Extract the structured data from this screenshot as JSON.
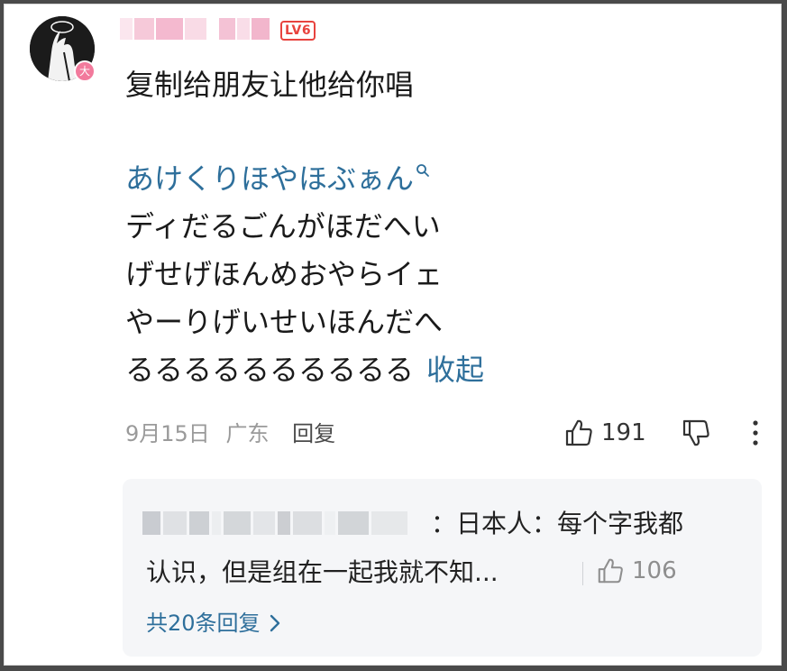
{
  "user": {
    "level": "LV6",
    "avatar_badge": "大"
  },
  "comment": {
    "intro": "复制给朋友让他给你唱",
    "song_link": "あけくりほやほぶぁん",
    "lines": [
      "ディだるごんがほだへい",
      "げせげほんめおやらイェ",
      "やーりげいせいほんだへ"
    ],
    "last_line": "るるるるるるるるるる",
    "collapse_label": "收起"
  },
  "meta": {
    "date": "9月15日",
    "location": "广东",
    "reply_label": "回复",
    "like_count": "191"
  },
  "replies": {
    "first_reply_text_line1": "：日本人：每个字我都",
    "first_reply_text_line2": "认识，但是组在一起我就不知...",
    "first_reply_likes": "106",
    "view_all_label": "共20条回复"
  },
  "colors": {
    "link": "#2e6f9b",
    "level_badge": "#e8433e",
    "avatar_badge": "#f27a9c"
  },
  "icons": {
    "like": "thumbs-up-icon",
    "dislike": "thumbs-down-icon",
    "more": "more-vertical-icon",
    "search": "search-icon",
    "chevron": "chevron-right-icon"
  }
}
